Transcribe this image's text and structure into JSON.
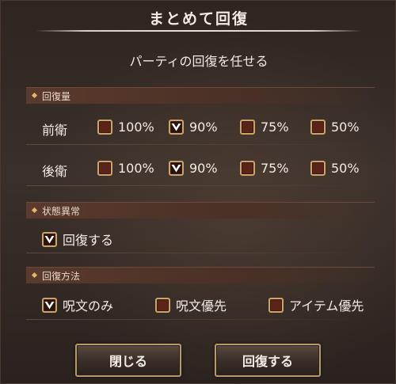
{
  "dialog": {
    "title": "まとめて回復",
    "subtitle": "パーティの回復を任せる"
  },
  "recovery_amount": {
    "header": "回復量",
    "rows": [
      {
        "label": "前衛",
        "options": [
          {
            "label": "100%",
            "checked": false
          },
          {
            "label": "90%",
            "checked": true
          },
          {
            "label": "75%",
            "checked": false
          },
          {
            "label": "50%",
            "checked": false
          }
        ]
      },
      {
        "label": "後衛",
        "options": [
          {
            "label": "100%",
            "checked": false
          },
          {
            "label": "90%",
            "checked": true
          },
          {
            "label": "75%",
            "checked": false
          },
          {
            "label": "50%",
            "checked": false
          }
        ]
      }
    ]
  },
  "status_ailment": {
    "header": "状態異常",
    "option": {
      "label": "回復する",
      "checked": true
    }
  },
  "recovery_method": {
    "header": "回復方法",
    "options": [
      {
        "label": "呪文のみ",
        "checked": true
      },
      {
        "label": "呪文優先",
        "checked": false
      },
      {
        "label": "アイテム優先",
        "checked": false
      }
    ]
  },
  "buttons": {
    "close": "閉じる",
    "recover": "回復する"
  },
  "colors": {
    "checkbox_border": "#c9a56a",
    "checkbox_fill": "#5a2418",
    "checkmark": "#ffffff",
    "section_header": "#5a3a2c",
    "accent_diamond": "#e0b86a"
  }
}
